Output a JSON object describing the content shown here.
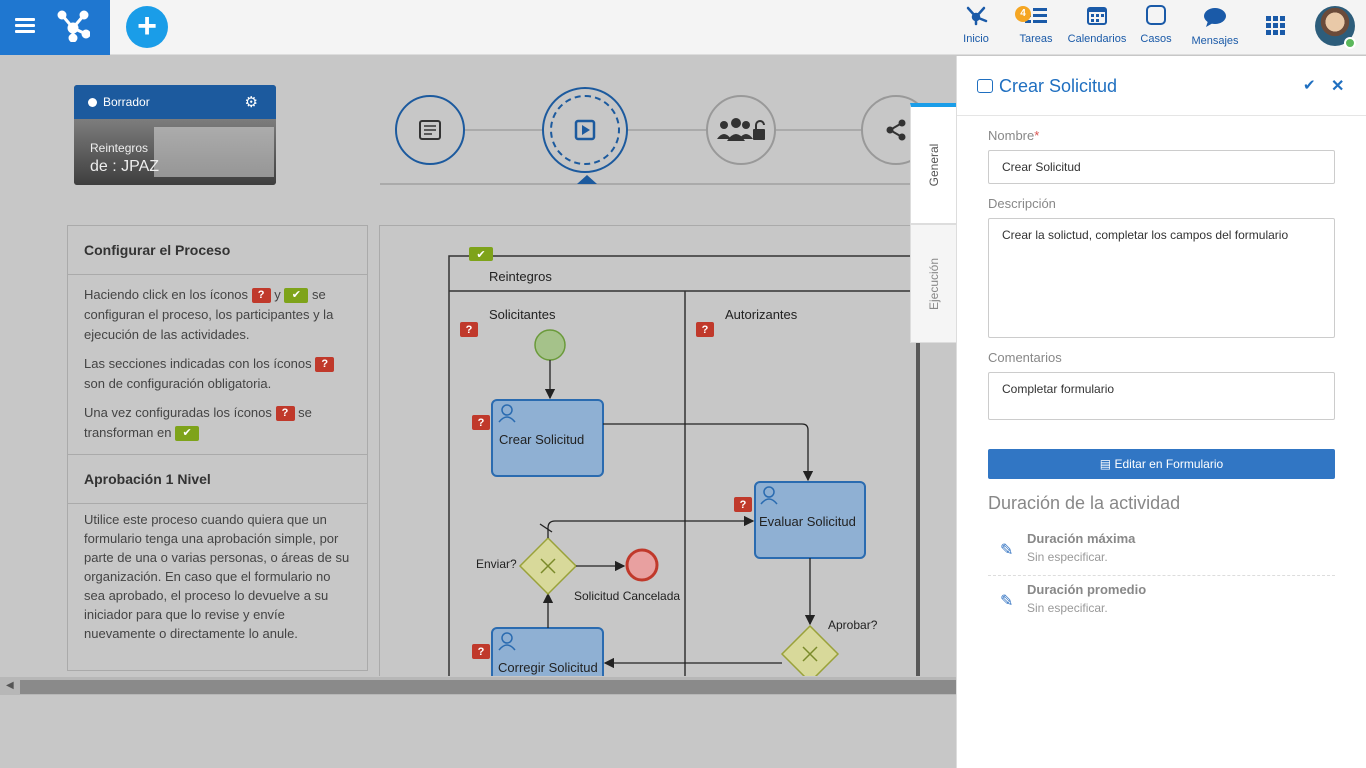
{
  "topbar": {
    "nav": [
      {
        "label": "Inicio",
        "icon": "hierarchy-icon"
      },
      {
        "label": "Tareas",
        "icon": "tasks-icon",
        "badge": "4"
      },
      {
        "label": "Calendarios",
        "icon": "calendar-icon"
      },
      {
        "label": "Casos",
        "icon": "cases-icon"
      },
      {
        "label": "Mensajes",
        "icon": "chat-icon"
      }
    ],
    "add_label": "+"
  },
  "process_card": {
    "status": "Borrador",
    "line1": "Reintegros",
    "line2": "de : JPAZ"
  },
  "help": {
    "title1": "Configurar el Proceso",
    "p1a": "Haciendo click en los íconos",
    "p1b": "y",
    "p1c": "se configuran el proceso, los participantes y la ejecución de las actividades.",
    "p2a": "Las secciones indicadas con los íconos",
    "p2b": "son de configuración obligatoria.",
    "p3a": "Una vez configuradas los íconos",
    "p3b": "se transforman en",
    "title2": "Aprobación 1 Nivel",
    "desc": "Utilice este proceso cuando quiera que un formulario tenga una aprobación simple, por parte de una o varias personas, o áreas de su organización. En caso que el formulario no sea aprobado, el proceso lo devuelve a su iniciador para que lo revise y envíe nuevamente o directamente lo anule.",
    "q": "?",
    "check": "✔"
  },
  "diagram": {
    "pool": "Reintegros",
    "lane1": "Solicitantes",
    "lane2": "Autorizantes",
    "task_crear": "Crear Solicitud",
    "task_evaluar": "Evaluar Solicitud",
    "task_corregir": "Corregir Solicitud",
    "gw_enviar": "Enviar?",
    "gw_aprobar": "Aprobar?",
    "end_cancel": "Solicitud Cancelada"
  },
  "tabs": {
    "general": "General",
    "ejecucion": "Ejecución"
  },
  "panel": {
    "title": "Crear Solicitud",
    "nombre_label": "Nombre",
    "nombre_value": "Crear Solicitud",
    "desc_label": "Descripción",
    "desc_value": "Crear la solictud, completar los campos del formulario",
    "coment_label": "Comentarios",
    "coment_value": "Completar formulario",
    "edit_button": "Editar en Formulario",
    "duracion_title": "Duración de la actividad",
    "dur_max": "Duración máxima",
    "dur_max_val": "Sin especificar.",
    "dur_prom": "Duración promedio",
    "dur_prom_val": "Sin especificar."
  },
  "colors": {
    "brand": "#1f77d0",
    "accent": "#1a9de8",
    "required": "#c0392b",
    "configured": "#7ea31a"
  }
}
